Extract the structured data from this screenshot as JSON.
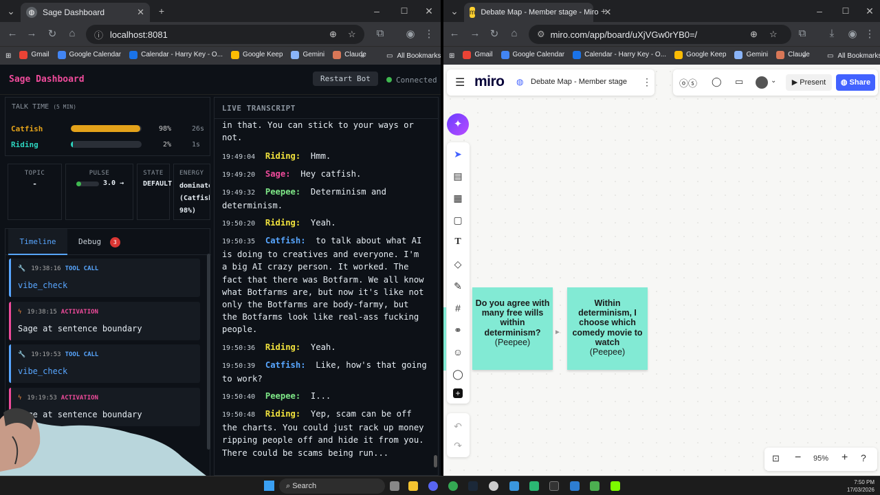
{
  "left_browser": {
    "tab_title": "Sage Dashboard",
    "url": "localhost:8081",
    "bookmarks": [
      {
        "label": "Gmail",
        "color": "#ea4335"
      },
      {
        "label": "Google Calendar",
        "color": "#4285f4"
      },
      {
        "label": "Calendar - Harry Key - O...",
        "color": "#1a73e8"
      },
      {
        "label": "Google Keep",
        "color": "#fbbc04"
      },
      {
        "label": "Gemini",
        "color": "#8ab4f8"
      },
      {
        "label": "Claude",
        "color": "#d97757"
      }
    ],
    "all_bookmarks": "All Bookmarks"
  },
  "sage": {
    "title": "Sage Dashboard",
    "restart_label": "Restart Bot",
    "status": "Connected",
    "talk_time": {
      "label": "TALK TIME",
      "window": "(5 MIN)",
      "rows": [
        {
          "name": "Catfish",
          "pct": "98%",
          "secs": "26s",
          "fraction": 0.98,
          "color": "#e3a21a"
        },
        {
          "name": "Riding",
          "pct": "2%",
          "secs": "1s",
          "fraction": 0.02,
          "color": "#2dd4bf"
        }
      ]
    },
    "stats": {
      "topic_label": "TOPIC",
      "topic_value": "-",
      "pulse_label": "PULSE",
      "pulse_value": "3.0 →",
      "pulse_fraction": 0.06,
      "state_label": "STATE",
      "state_value": "DEFAULT",
      "energy_label": "ENERGY",
      "energy_line1": "dominate",
      "energy_line2": "(Catfish",
      "energy_line3": "98%)"
    },
    "tabs": {
      "timeline": "Timeline",
      "debug": "Debug",
      "debug_count": "3"
    },
    "timeline": [
      {
        "time": "19:38:16",
        "kind": "TOOL CALL",
        "value": "vibe_check",
        "icon": "wrench-icon",
        "accent": "#58a6ff"
      },
      {
        "time": "19:38:15",
        "kind": "ACTIVATION",
        "value": "Sage at sentence boundary",
        "icon": "lightning-icon",
        "accent": "#ef4b9b"
      },
      {
        "time": "19:19:53",
        "kind": "TOOL CALL",
        "value": "vibe_check",
        "icon": "wrench-icon",
        "accent": "#58a6ff"
      },
      {
        "time": "19:19:53",
        "kind": "ACTIVATION",
        "value": "Sage at sentence boundary",
        "icon": "lightning-icon",
        "accent": "#ef4b9b"
      }
    ],
    "transcript_label": "LIVE TRANSCRIPT",
    "transcript": [
      {
        "time": "",
        "speaker": "",
        "text": "in that. You can stick to your ways or not."
      },
      {
        "time": "19:49:04",
        "speaker": "Riding:",
        "text": "Hmm."
      },
      {
        "time": "19:49:20",
        "speaker": "Sage:",
        "text": "Hey catfish."
      },
      {
        "time": "19:49:32",
        "speaker": "Peepee:",
        "text": "Determinism and determinism."
      },
      {
        "time": "19:50:20",
        "speaker": "Riding:",
        "text": "Yeah."
      },
      {
        "time": "19:50:35",
        "speaker": "Catfish:",
        "text": "to talk about what AI is doing to creatives and everyone. I'm a big AI crazy person. It worked. The fact that there was Botfarm. We all know what Botfarms are, but now it's like not only the Botfarms are body-farmy, but the Botfarms look like real-ass fucking people."
      },
      {
        "time": "19:50:36",
        "speaker": "Riding:",
        "text": "Yeah."
      },
      {
        "time": "19:50:39",
        "speaker": "Catfish:",
        "text": "Like, how's that going to work?"
      },
      {
        "time": "19:50:40",
        "speaker": "Peepee:",
        "text": "I..."
      },
      {
        "time": "19:50:48",
        "speaker": "Riding:",
        "text": "Yep, scam can be off the charts. You could just rack up money ripping people off and hide it from you. There could be scams being run..."
      }
    ],
    "speaker_colors": {
      "Riding:": "#f2e33d",
      "Sage:": "#ef4b9b",
      "Peepee:": "#7ee787",
      "Catfish:": "#58a6ff"
    }
  },
  "right_browser": {
    "tab_title": "Debate Map - Member stage - Miro",
    "url": "miro.com/app/board/uXjVGw0rYB0=/",
    "bookmarks": [
      {
        "label": "Gmail",
        "color": "#ea4335"
      },
      {
        "label": "Google Calendar",
        "color": "#4285f4"
      },
      {
        "label": "Calendar - Harry Key - O...",
        "color": "#1a73e8"
      },
      {
        "label": "Google Keep",
        "color": "#fbbc04"
      },
      {
        "label": "Gemini",
        "color": "#8ab4f8"
      },
      {
        "label": "Claude",
        "color": "#d97757"
      }
    ],
    "all_bookmarks": "All Bookmarks"
  },
  "miro": {
    "logo": "miro",
    "board_name": "Debate Map - Member stage",
    "present_label": "Present",
    "share_label": "Share",
    "zoom": "95%",
    "stickies": [
      {
        "text": "Do you agree with many free wills within determinism?",
        "author": "(Peepee)"
      },
      {
        "text": "Within determinism, I choose which comedy movie to watch",
        "author": "(Peepee)"
      }
    ],
    "offscreen_fragment": "y\nt"
  },
  "taskbar": {
    "search": "Search",
    "time": "7:50 PM",
    "date": "17/03/2026"
  }
}
